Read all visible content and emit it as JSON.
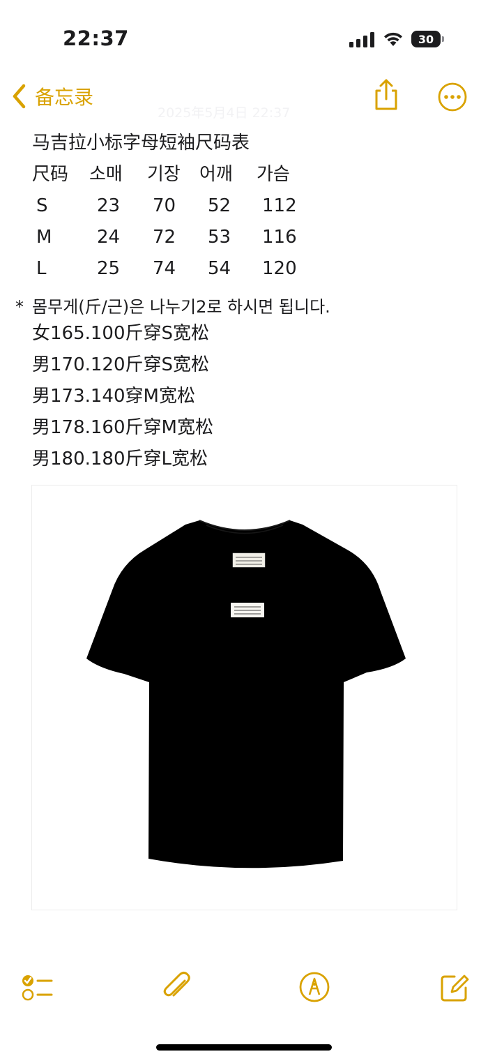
{
  "status_bar": {
    "time": "22:37",
    "battery_level": "30"
  },
  "nav": {
    "back_label": "备忘录",
    "note_date": "2025年5月4日 22:37"
  },
  "note": {
    "title": "马吉拉小标字母短袖尺码表",
    "size_table": {
      "headers": [
        "尺码",
        "소매",
        "기장",
        "어깨",
        "가슴"
      ],
      "rows": [
        [
          "S",
          "23",
          "70",
          "52",
          "112"
        ],
        [
          "M",
          "24",
          "72",
          "53",
          "116"
        ],
        [
          "L",
          "25",
          "74",
          "54",
          "120"
        ]
      ]
    },
    "bullet": {
      "marker": "*",
      "text": "몸무게(斤/근)은 나누기2로 하시면 됩니다."
    },
    "fit_lines": [
      "女165.100斤穿S宽松",
      "男170.120斤穿S宽松",
      "男173.140穿M宽松",
      "男178.160斤穿M宽松",
      "男180.180斤穿L宽松"
    ]
  },
  "image": {
    "subject": "black-tshirt-with-white-label"
  },
  "toolbar": {
    "icons": [
      "checklist-icon",
      "paperclip-icon",
      "markup-pen-icon",
      "compose-icon"
    ]
  },
  "colors": {
    "accent": "#D9A200",
    "text": "#1C1C1E",
    "background": "#FFFFFF"
  }
}
